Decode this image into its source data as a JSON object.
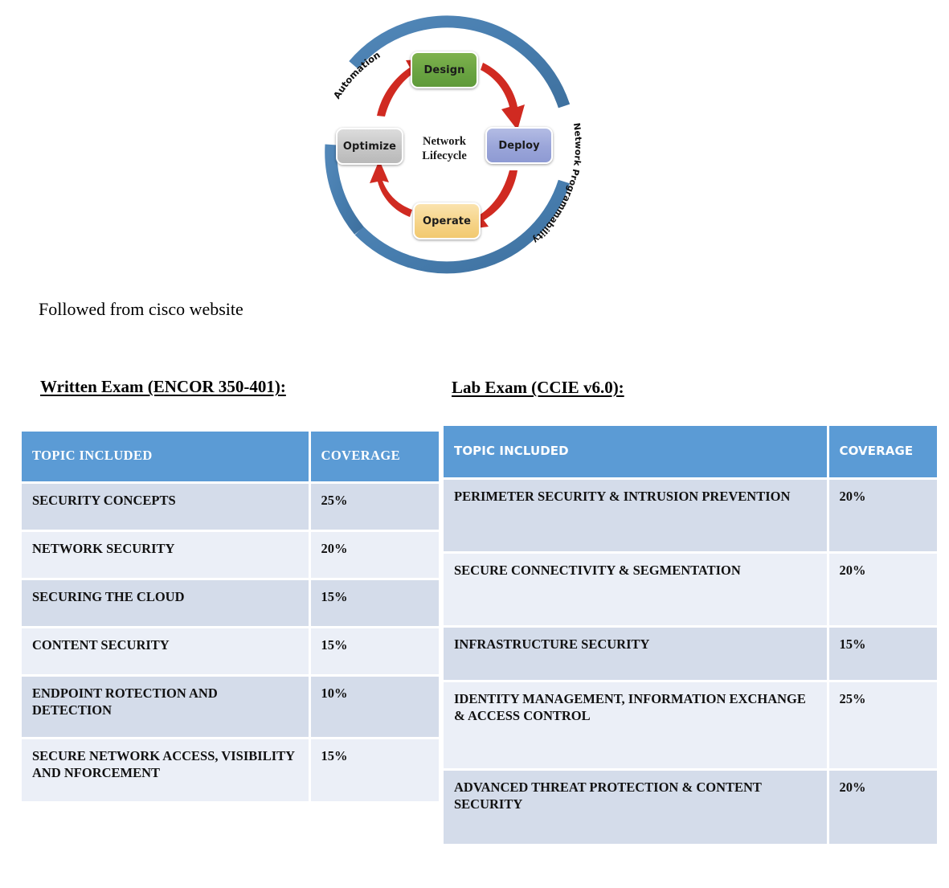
{
  "diagram": {
    "title": "Network Lifecycle",
    "center_label_line1": "Network",
    "center_label_line2": "Lifecycle",
    "ring_color": "#4A7EB0",
    "arrow_color": "#D32B22",
    "outer_labels": [
      {
        "text": "Automation",
        "position": "upper-left"
      },
      {
        "text": "Network Programmability",
        "position": "right"
      }
    ],
    "nodes": [
      {
        "id": "design",
        "label": "Design",
        "color": "#6AA442"
      },
      {
        "id": "deploy",
        "label": "Deploy",
        "color": "#9AA5D9"
      },
      {
        "id": "operate",
        "label": "Operate",
        "color": "#F6D489"
      },
      {
        "id": "optimize",
        "label": "Optimize",
        "color": "#C6C6C6"
      }
    ]
  },
  "caption": {
    "cisco_source": "Followed from cisco website"
  },
  "written_exam": {
    "heading": "Written Exam (ENCOR 350-401):",
    "columns": [
      "TOPIC INCLUDED",
      "COVERAGE"
    ],
    "rows": [
      {
        "topic": " SECURITY CONCEPTS",
        "coverage": "25%"
      },
      {
        "topic": "NETWORK SECURITY",
        "coverage": "20%"
      },
      {
        "topic": "SECURING THE CLOUD",
        "coverage": "15%"
      },
      {
        "topic": "CONTENT SECURITY",
        "coverage": "15%"
      },
      {
        "topic": "ENDPOINT ROTECTION AND DETECTION",
        "coverage": "10%"
      },
      {
        "topic": "SECURE NETWORK ACCESS, VISIBILITY AND NFORCEMENT",
        "coverage": "15%"
      }
    ]
  },
  "lab_exam": {
    "heading": "Lab Exam (CCIE v6.0):",
    "columns": [
      "TOPIC INCLUDED",
      "COVERAGE"
    ],
    "rows": [
      {
        "topic": "PERIMETER SECURITY & INTRUSION PREVENTION",
        "coverage": "20%"
      },
      {
        "topic": "SECURE CONNECTIVITY & SEGMENTATION",
        "coverage": "20%"
      },
      {
        "topic": "INFRASTRUCTURE SECURITY",
        "coverage": "15%"
      },
      {
        "topic": "IDENTITY MANAGEMENT, INFORMATION EXCHANGE & ACCESS CONTROL",
        "coverage": "25%"
      },
      {
        "topic": "ADVANCED THREAT PROTECTION & CONTENT SECURITY",
        "coverage": "20%"
      }
    ]
  },
  "colors": {
    "table_header": "#5B9BD5",
    "row_dark": "#D4DCEA",
    "row_light": "#EBEFF7"
  }
}
